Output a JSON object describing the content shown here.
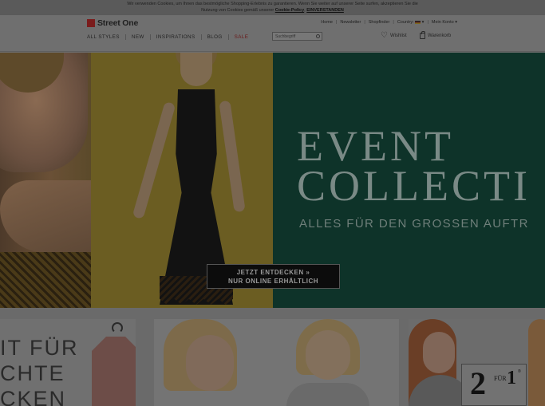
{
  "cookie": {
    "line1": "Wir verwenden Cookies, um Ihnen das bestmögliche Shopping-Erlebnis zu garantieren. Wenn Sie weiter auf unserer Seite surfen, akzeptieren Sie die",
    "line2_prefix": "Nutzung von Cookies gemäß unserer",
    "policy_link": "Cookie-Policy",
    "agree_link": "EINVERSTANDEN"
  },
  "header": {
    "brand": "Street One",
    "utility": {
      "home": "Home",
      "newsletter": "Newsletter",
      "shopfinder": "Shopfinder",
      "country": "Country:",
      "account": "Mein Konto"
    },
    "nav": [
      "ALL STYLES",
      "NEW",
      "INSPIRATIONS",
      "BLOG",
      "SALE"
    ],
    "search_placeholder": "Suchbegriff",
    "wishlist": "Wishlist",
    "cart": "Warenkorb"
  },
  "hero": {
    "title_line1": "EVENT",
    "title_line2": "COLLECTI",
    "subtitle": "ALLES FÜR DEN GROSSEN AUFTR",
    "cta_line1": "JETZT ENTDECKEN »",
    "cta_line2": "NUR ONLINE ERHÄLTLICH"
  },
  "lower": {
    "tile1_line1": "IT FÜR",
    "tile1_line2": "CHTE",
    "tile1_line3": "CKEN",
    "offer_big": "2",
    "offer_small": "FÜR",
    "offer_one": "1",
    "offer_reg": "®"
  }
}
